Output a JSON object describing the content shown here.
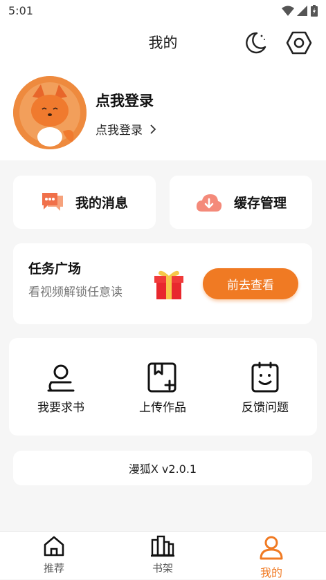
{
  "status": {
    "time": "5:01"
  },
  "header": {
    "title": "我的",
    "icons": [
      "moon-icon",
      "settings-icon"
    ]
  },
  "profile": {
    "title": "点我登录",
    "subtitle": "点我登录"
  },
  "quick_actions": [
    {
      "label": "我的消息",
      "icon": "chat-icon"
    },
    {
      "label": "缓存管理",
      "icon": "cloud-download-icon"
    }
  ],
  "task": {
    "title": "任务广场",
    "subtitle": "看视频解锁任意读",
    "button": "前去查看",
    "icon": "gift-icon"
  },
  "tools": [
    {
      "label": "我要求书",
      "icon": "request-book-icon"
    },
    {
      "label": "上传作品",
      "icon": "upload-work-icon"
    },
    {
      "label": "反馈问题",
      "icon": "feedback-icon"
    }
  ],
  "version": "漫狐X v2.0.1",
  "bottom_nav": [
    {
      "label": "推荐",
      "icon": "home-icon",
      "active": false
    },
    {
      "label": "书架",
      "icon": "bookshelf-icon",
      "active": false
    },
    {
      "label": "我的",
      "icon": "profile-icon",
      "active": true
    }
  ],
  "colors": {
    "accent": "#f07a23",
    "background": "#f6f6f6",
    "card": "#ffffff"
  }
}
